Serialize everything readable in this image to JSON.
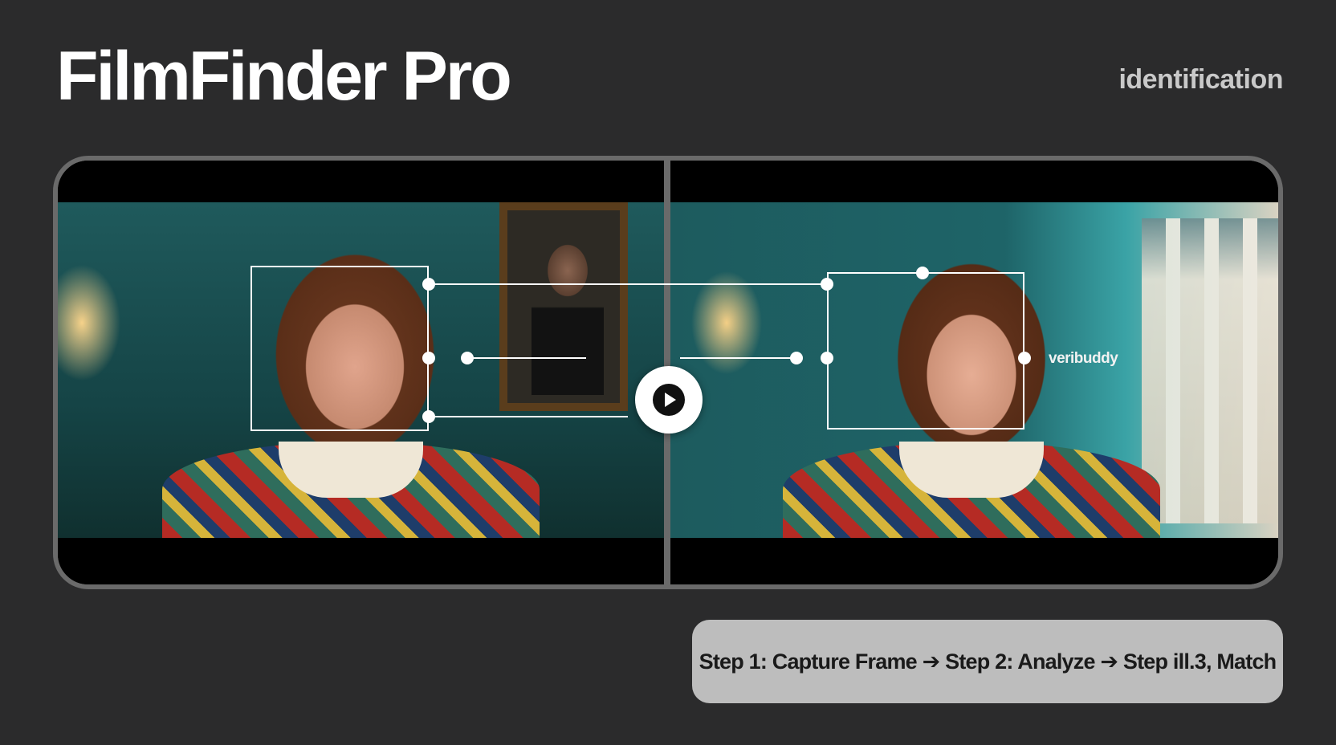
{
  "header": {
    "title": "FilmFinder Pro",
    "subtitle": "identification"
  },
  "viewer": {
    "play_icon": "play-icon",
    "watermark": "veribuddy"
  },
  "steps": {
    "text": "Step 1: Capture Frame ➔ Step 2: Analyze ➔ Step ill.3, Match"
  },
  "colors": {
    "background": "#2b2b2c",
    "viewer_border": "#6a6a6a",
    "steps_bar": "#bdbdbd",
    "overlay": "#ffffff"
  }
}
